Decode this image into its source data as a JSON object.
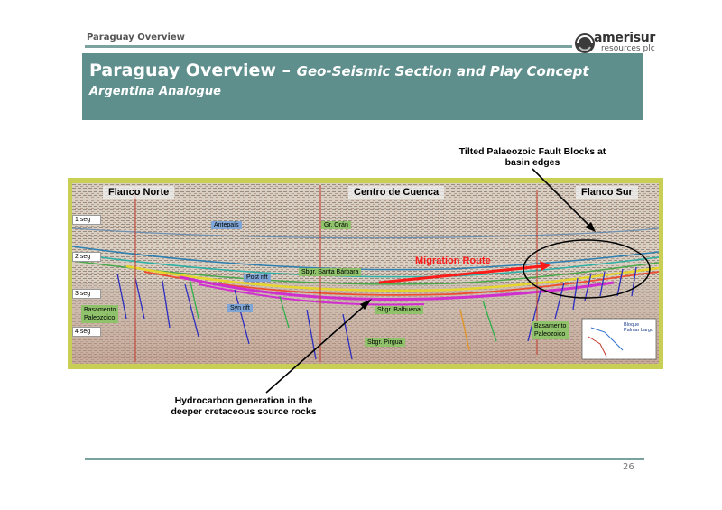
{
  "header": {
    "section_label": "Paraguay Overview",
    "logo_line1": "amerisur",
    "logo_line2": "resources plc"
  },
  "title": {
    "main": "Paraguay Overview",
    "dash": " – ",
    "sub": "Geo-Seismic Section and Play Concept",
    "line2": "Argentina Analogue"
  },
  "callouts": {
    "top_line1": "Tilted Palaeozoic Fault Blocks at",
    "top_line2": "basin edges",
    "bottom_line1": "Hydrocarbon generation in the",
    "bottom_line2": "deeper cretaceous source rocks"
  },
  "seismic": {
    "regions": [
      "Flanco Norte",
      "Centro de Cuenca",
      "Flanco Sur"
    ],
    "time_ticks": [
      "1 seg",
      "2 seg",
      "3 seg",
      "4 seg"
    ],
    "labels": {
      "antepais": "Antepaís",
      "gr_oran": "Gr. Orán",
      "post_rift": "Post rift",
      "syn_rift": "Syn rift",
      "sbgr_santa_barbara": "Sbgr. Santa Bárbara",
      "sbgr_balbuena": "Sbgr. Balbuena",
      "sbgr_pirgua": "Sbgr. Pirgua",
      "basamento_left_1": "Basamento",
      "basamento_left_2": "Paleozoico",
      "basamento_right_1": "Basamento",
      "basamento_right_2": "Paleozoico",
      "migration_route": "Migration Route",
      "inset_1": "Bloque",
      "inset_2": "Palmar Largo"
    },
    "colors": {
      "frame": "#c9cf55",
      "migration": "#ff1a1a",
      "faults": "#2d2dbf",
      "source_rock": "#d02fd0"
    }
  },
  "footer": {
    "page_number": "26"
  }
}
